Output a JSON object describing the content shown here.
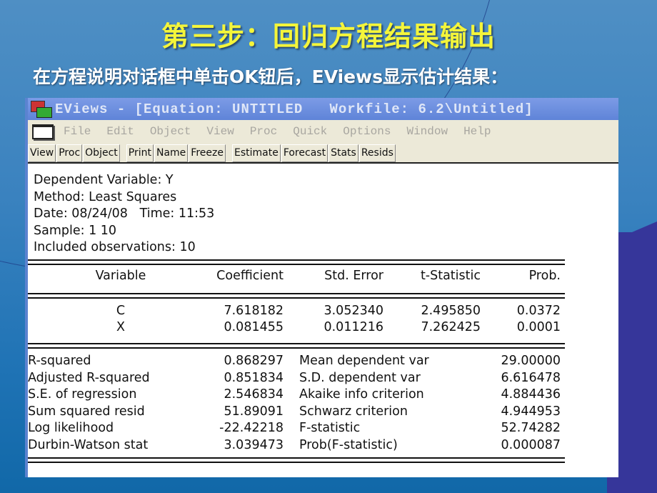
{
  "slide": {
    "title": "第三步：回归方程结果输出",
    "subtitle": "在方程说明对话框中单击OK钮后，EViews显示估计结果："
  },
  "window": {
    "title": "EViews - [Equation: UNTITLED   Workfile: 6.2\\Untitled]",
    "app_icon": "eviews-app-icon",
    "menu": [
      "File",
      "Edit",
      "Object",
      "View",
      "Proc",
      "Quick",
      "Options",
      "Window",
      "Help"
    ],
    "toolbar": [
      "View",
      "Proc",
      "Object",
      "Print",
      "Name",
      "Freeze",
      "Estimate",
      "Forecast",
      "Stats",
      "Resids"
    ]
  },
  "output": {
    "header": [
      "Dependent Variable: Y",
      "Method: Least Squares",
      "Date: 08/24/08   Time: 11:53",
      "Sample: 1 10",
      "Included observations: 10"
    ],
    "columns": [
      "Variable",
      "Coefficient",
      "Std. Error",
      "t-Statistic",
      "Prob."
    ],
    "rows": [
      [
        "C",
        "7.618182",
        "3.052340",
        "2.495850",
        "0.0372"
      ],
      [
        "X",
        "0.081455",
        "0.011216",
        "7.262425",
        "0.0001"
      ]
    ],
    "stats_left": [
      [
        "R-squared",
        "0.868297"
      ],
      [
        "Adjusted R-squared",
        "0.851834"
      ],
      [
        "S.E. of regression",
        "2.546834"
      ],
      [
        "Sum squared resid",
        "51.89091"
      ],
      [
        "Log likelihood",
        "-22.42218"
      ],
      [
        "Durbin-Watson stat",
        "3.039473"
      ]
    ],
    "stats_right": [
      [
        "Mean dependent var",
        "29.00000"
      ],
      [
        "S.D. dependent var",
        "6.616478"
      ],
      [
        "Akaike info criterion",
        "4.884436"
      ],
      [
        "Schwarz criterion",
        "4.944953"
      ],
      [
        "F-statistic",
        "52.74282"
      ],
      [
        "Prob(F-statistic)",
        "0.000087"
      ]
    ]
  }
}
